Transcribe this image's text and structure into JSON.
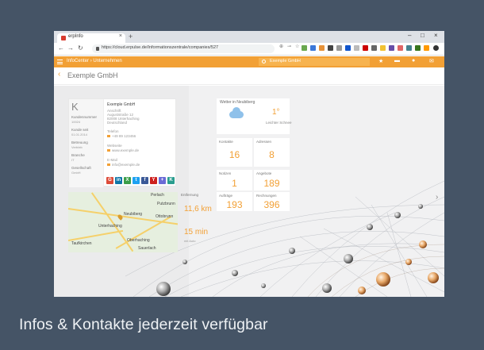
{
  "browser": {
    "tab_title": "erpInfo",
    "url": "https://cloud.erpulse.de/Informationszentrale/companies/527",
    "window_controls": [
      "–",
      "□",
      "×"
    ]
  },
  "app": {
    "breadcrumb_root": "InfoCenter",
    "breadcrumb_sep": "›",
    "breadcrumb_current": "Unternehmen",
    "search_text": "Exemple GmbH",
    "accent_color": "#f2a035"
  },
  "company": {
    "title": "Exemple GmbH",
    "initial": "K",
    "card_name": "Exemple GmbH",
    "address_label": "Anschrift",
    "address_value": "Auguststraße 12",
    "address_line2": "82008 Unterhaching",
    "address_line3": "Deutschland",
    "phone_label": "Telefon",
    "phone_value": "+49 89 123456",
    "web_label": "Webseite",
    "web_value": "www.exemple.de",
    "email_label": "E-Mail",
    "email_value": "info@exemple.de",
    "left_meta": [
      {
        "label": "Kundennummer",
        "value": "10024"
      },
      {
        "label": "Kunde seit",
        "value": "01.01.2014"
      },
      {
        "label": "Betreuung",
        "value": "Vertrieb"
      },
      {
        "label": "Branche",
        "value": "IT"
      },
      {
        "label": "Gesellschaft",
        "value": "GmbH"
      }
    ]
  },
  "social": [
    {
      "letter": "G",
      "color": "#dd4b39",
      "icon": "google-icon"
    },
    {
      "letter": "in",
      "color": "#0e76a8",
      "icon": "linkedin-icon"
    },
    {
      "letter": "X",
      "color": "#3b9e4a",
      "icon": "xing-icon"
    },
    {
      "letter": "t",
      "color": "#1da1f2",
      "icon": "twitter-icon"
    },
    {
      "letter": "f",
      "color": "#3b5998",
      "icon": "facebook-icon"
    },
    {
      "letter": "Y",
      "color": "#cd201f",
      "icon": "youtube-icon"
    },
    {
      "letter": "+",
      "color": "#6b6bd6",
      "icon": "instagram-icon"
    },
    {
      "letter": "K",
      "color": "#2a9d8f",
      "icon": "kununu-icon"
    }
  ],
  "weather": {
    "title": "Wetter in Neubiberg",
    "temp": "1°",
    "desc": "Leichter Schnee"
  },
  "tiles": [
    {
      "label": "Kontakte",
      "value": "16"
    },
    {
      "label": "Adressen",
      "value": "8"
    },
    {
      "label": "Notizen",
      "value": "1"
    },
    {
      "label": "Angebote",
      "value": "189"
    },
    {
      "label": "Aufträge",
      "value": "193"
    },
    {
      "label": "Rechnungen",
      "value": "396"
    }
  ],
  "distance": {
    "label": "Entfernung",
    "km": "11,6 km",
    "time": "15 min",
    "mode": "mit Auto"
  },
  "map": {
    "labels": [
      "Perlach",
      "Neubiberg",
      "Ottobrunn",
      "Unterhaching",
      "Taufkirchen",
      "Oberhaching",
      "Putzbrunn",
      "Sauerlach"
    ]
  },
  "caption": "Infos & Kontakte jederzeit verfügbar"
}
